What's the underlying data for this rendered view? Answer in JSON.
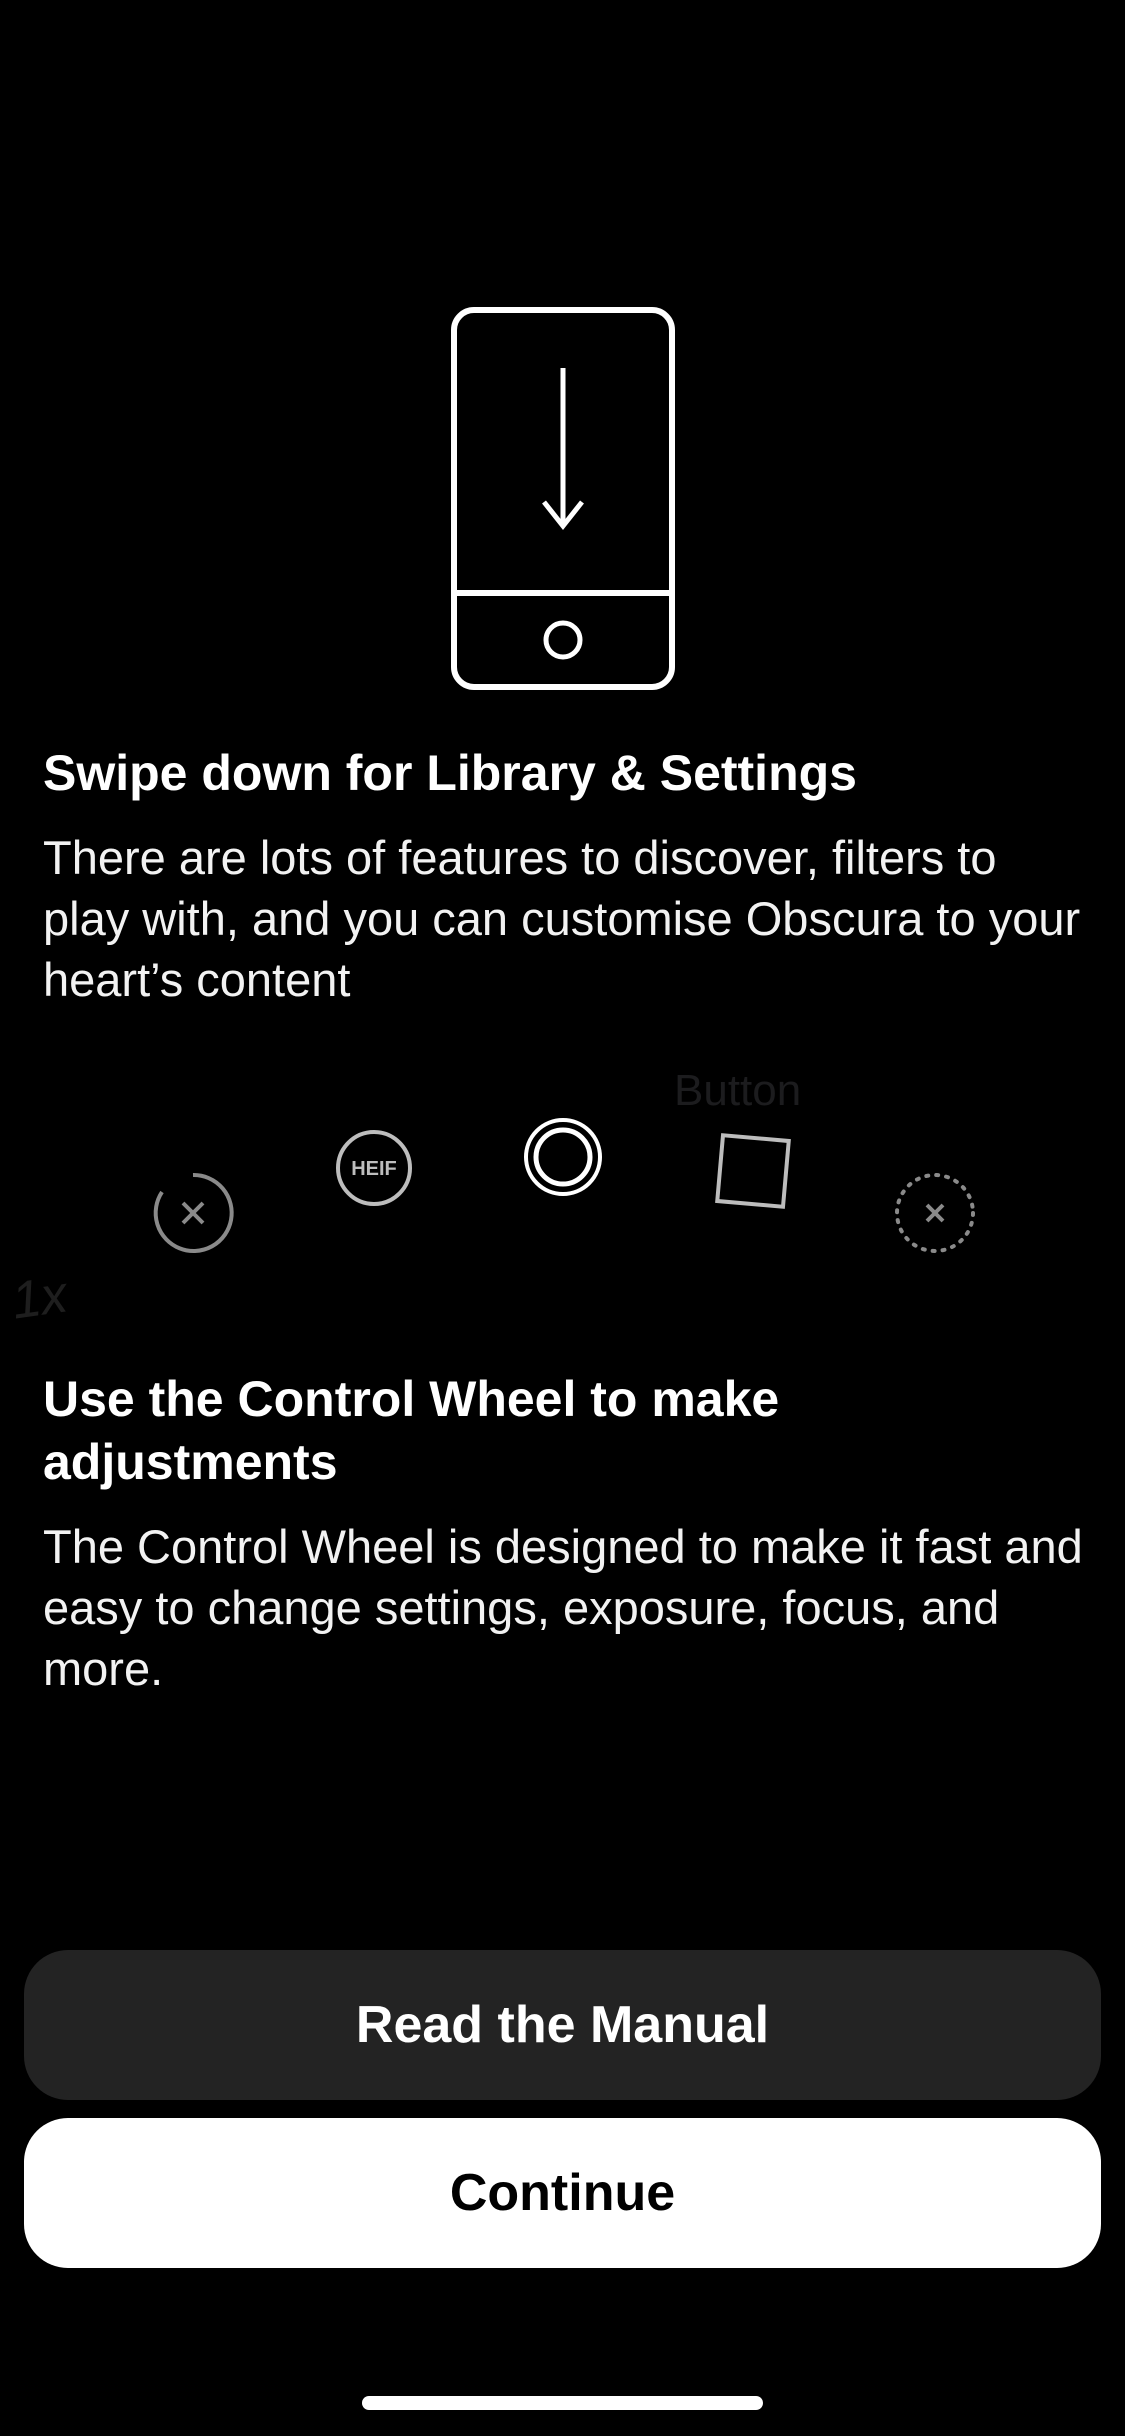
{
  "illustration": {
    "icon": "phone-swipe-down-icon"
  },
  "library_section": {
    "title": "Swipe down for Library & Settings",
    "body": "There are lots of features to discover, filters to play with, and you can customise Obscura to your heart’s content"
  },
  "control_wheel": {
    "hint_label": "Button",
    "zoom_label": "1x",
    "items": [
      {
        "icon": "timer-off-icon"
      },
      {
        "icon": "heif-format-icon",
        "label": "HEIF"
      },
      {
        "icon": "shutter-ring-icon"
      },
      {
        "icon": "crop-square-icon"
      },
      {
        "icon": "flash-off-dotted-icon"
      }
    ]
  },
  "wheel_section": {
    "title": "Use the Control Wheel to make adjustments",
    "body": "The Control Wheel is designed to make it fast and easy to change settings, exposure, focus, and more."
  },
  "buttons": {
    "manual_label": "Read the Manual",
    "continue_label": "Continue"
  },
  "colors": {
    "background": "#000000",
    "secondary_button": "#232323",
    "primary_button": "#ffffff"
  }
}
